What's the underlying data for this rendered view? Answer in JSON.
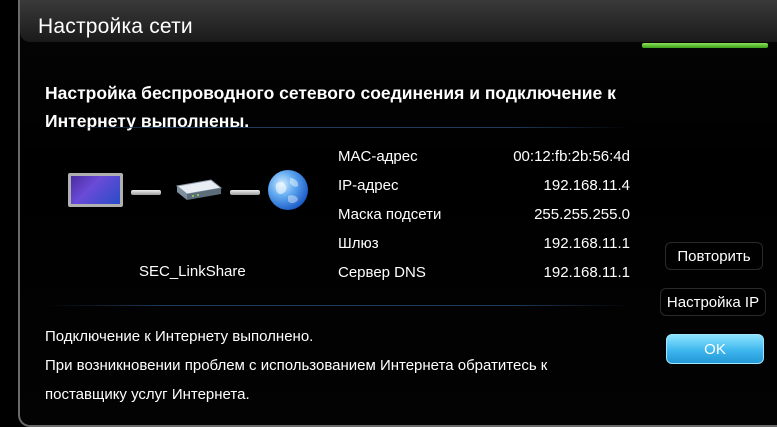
{
  "window": {
    "title": "Настройка сети"
  },
  "message": {
    "main": "Настройка беспроводного сетевого соединения и подключение к Интернету выполнены."
  },
  "network": {
    "ssid": "SEC_LinkShare",
    "details": [
      {
        "label": "MAC-адрес",
        "value": "00:12:fb:2b:56:4d"
      },
      {
        "label": "IP-адрес",
        "value": "192.168.11.4"
      },
      {
        "label": "Маска подсети",
        "value": "255.255.255.0"
      },
      {
        "label": "Шлюз",
        "value": "192.168.11.1"
      },
      {
        "label": "Сервер DNS",
        "value": "192.168.11.1"
      }
    ]
  },
  "status": {
    "line1": "Подключение к Интернету выполнено.",
    "line2": "При возникновении проблем с использованием Интернета обратитесь к",
    "line3": "поставщику услуг Интернета."
  },
  "buttons": {
    "retry": "Повторить",
    "ip_settings": "Настройка IP",
    "ok": "OK"
  },
  "icons": {
    "tv": "tv-icon",
    "router": "router-icon",
    "internet": "globe-icon"
  },
  "colors": {
    "accent": "#3fb6ee",
    "progress": "#5cc02a",
    "background": "#000000"
  }
}
